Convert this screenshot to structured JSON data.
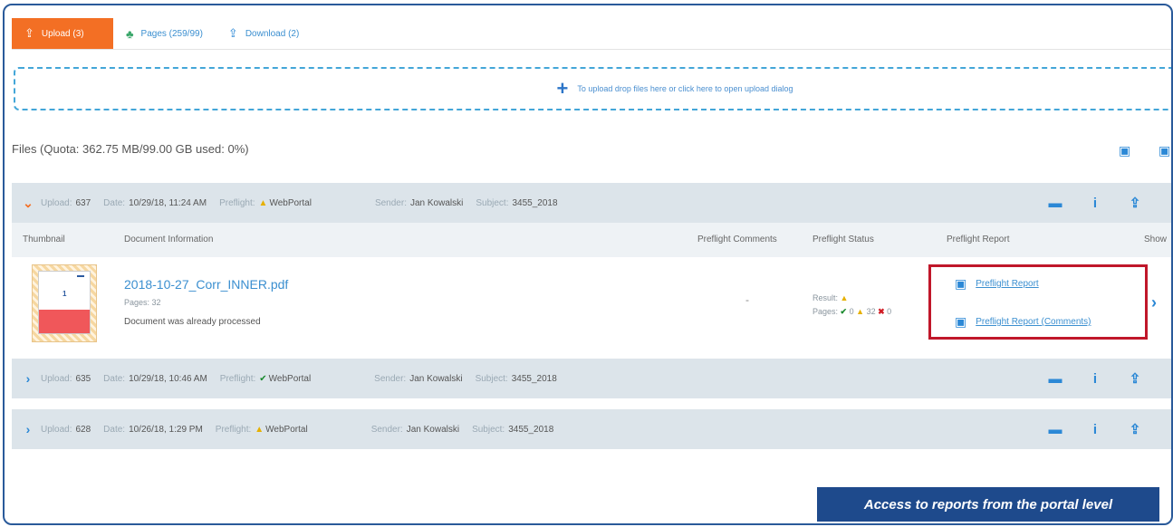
{
  "tabs": [
    {
      "label": "Upload (3)",
      "icon": "upload-icon"
    },
    {
      "label": "Pages (259/99)",
      "icon": "pages-icon"
    },
    {
      "label": "Download (2)",
      "icon": "download-icon"
    }
  ],
  "dropzone": {
    "text": "To upload drop files here or click here to open upload dialog"
  },
  "files_title": "Files (Quota: 362.75 MB/99.00 GB used: 0%)",
  "labels": {
    "upload": "Upload:",
    "date": "Date:",
    "preflight": "Preflight:",
    "sender": "Sender:",
    "subject": "Subject:"
  },
  "uploads": [
    {
      "id": "637",
      "date": "10/29/18, 11:24 AM",
      "preflight_status": "warning",
      "preflight": "WebPortal",
      "sender": "Jan Kowalski",
      "subject": "3455_2018",
      "expanded": true
    },
    {
      "id": "635",
      "date": "10/29/18, 10:46 AM",
      "preflight_status": "ok",
      "preflight": "WebPortal",
      "sender": "Jan Kowalski",
      "subject": "3455_2018",
      "expanded": false
    },
    {
      "id": "628",
      "date": "10/26/18, 1:29 PM",
      "preflight_status": "warning",
      "preflight": "WebPortal",
      "sender": "Jan Kowalski",
      "subject": "3455_2018",
      "expanded": false
    }
  ],
  "columns": {
    "thumbnail": "Thumbnail",
    "document_information": "Document Information",
    "preflight_comments": "Preflight Comments",
    "preflight_status": "Preflight Status",
    "preflight_report": "Preflight Report",
    "show": "Show"
  },
  "document": {
    "name": "2018-10-27_Corr_INNER.pdf",
    "pages": "Pages: 32",
    "note": "Document was already processed",
    "comments": "-",
    "result_label": "Result:",
    "pages_label": "Pages:",
    "ok_count": "0",
    "warn_count": "32",
    "error_count": "0",
    "thumb_page_number": "1"
  },
  "reports": {
    "report": "Preflight Report",
    "report_comments": "Preflight Report (Comments)"
  },
  "caption": "Access to reports from the portal level",
  "colors": {
    "accent": "#f36f24",
    "blue": "#2b88d6",
    "highlight": "#c0172a",
    "caption_bg": "#1e4a8c"
  }
}
